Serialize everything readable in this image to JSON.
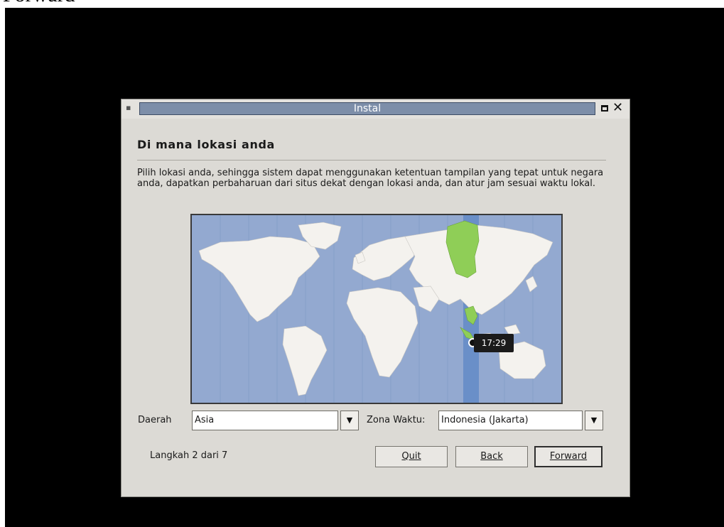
{
  "caption": "Forward",
  "window": {
    "title": "Instal",
    "icons": {
      "menu": "window-menu-icon",
      "maximize": "maximize-icon",
      "close": "close-icon"
    }
  },
  "page": {
    "heading": "Di mana lokasi anda",
    "description": "Pilih lokasi anda, sehingga sistem dapat menggunakan ketentuan tampilan yang tepat untuk negara anda, dapatkan perbaharuan dari situs dekat dengan lokasi anda, dan atur jam sesuai waktu lokal."
  },
  "map": {
    "time_label": "17:29",
    "colors": {
      "ocean": "#93a9d0",
      "land": "#f4f2ee",
      "selected_zone": "#6a8fc8",
      "highlight_land": "#8fce57"
    }
  },
  "region": {
    "label": "Daerah",
    "value": "Asia"
  },
  "timezone": {
    "label": "Zona Waktu:",
    "value": "Indonesia (Jakarta)"
  },
  "footer": {
    "step": "Langkah 2 dari 7",
    "quit": "Quit",
    "back": "Back",
    "forward": "Forward"
  }
}
